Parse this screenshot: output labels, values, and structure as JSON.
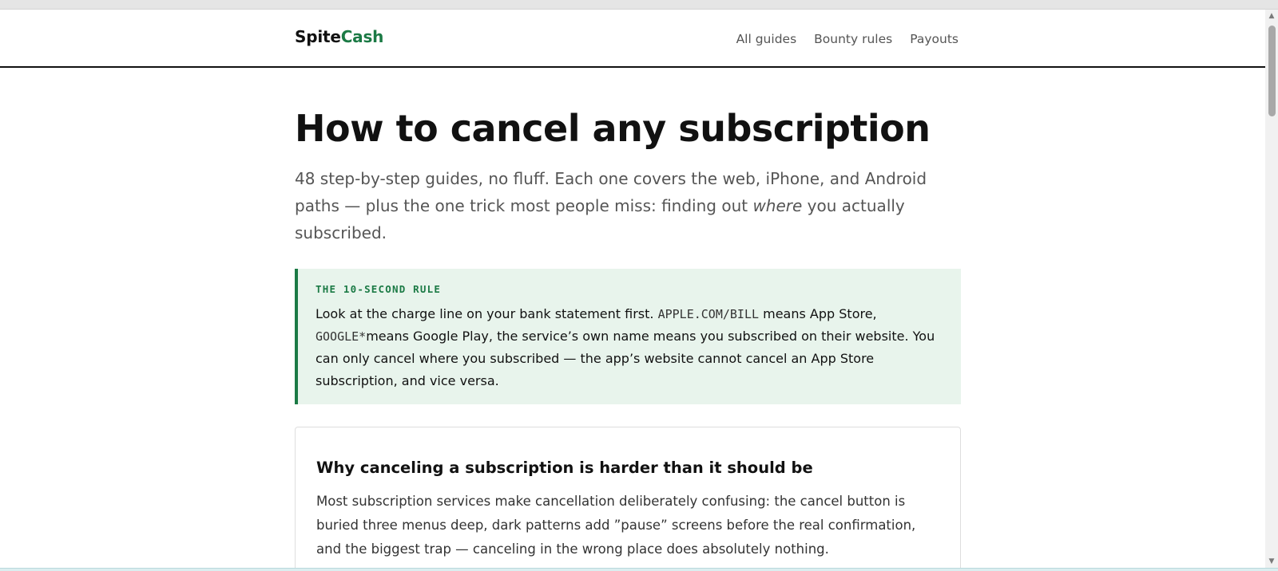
{
  "header": {
    "logo_part1": "Spite",
    "logo_part2": "Cash",
    "nav": [
      {
        "label": "All guides"
      },
      {
        "label": "Bounty rules"
      },
      {
        "label": "Payouts"
      }
    ]
  },
  "main": {
    "title": "How to cancel any subscription",
    "lede_before": "48 step-by-step guides, no fluff. Each one covers the web, iPhone, and Android paths — plus the one trick most people miss: finding out ",
    "lede_emphasis": "where",
    "lede_after": " you actually subscribed."
  },
  "rule_box": {
    "label": "THE 10-SECOND RULE",
    "text_1": "Look at the charge line on your bank statement first. ",
    "code_1": "APPLE.COM/BILL",
    "text_2": " means App Store, ",
    "code_2": "GOOGLE*",
    "text_3": "means Google Play, the service’s own name means you subscribed on their website. You can only cancel where you subscribed — the app’s website cannot cancel an App Store subscription, and vice versa."
  },
  "card": {
    "title": "Why canceling a subscription is harder than it should be",
    "text": "Most subscription services make cancellation deliberately confusing: the cancel button is buried three menus deep, dark patterns add ”pause” screens before the real confirmation, and the biggest trap — canceling in the wrong place does absolutely nothing."
  },
  "colors": {
    "brand_green": "#1b7a45",
    "callout_bg": "#e8f4ec",
    "muted_text": "#555555"
  },
  "icons": {
    "scroll_up": "▲",
    "scroll_down": "▼"
  }
}
